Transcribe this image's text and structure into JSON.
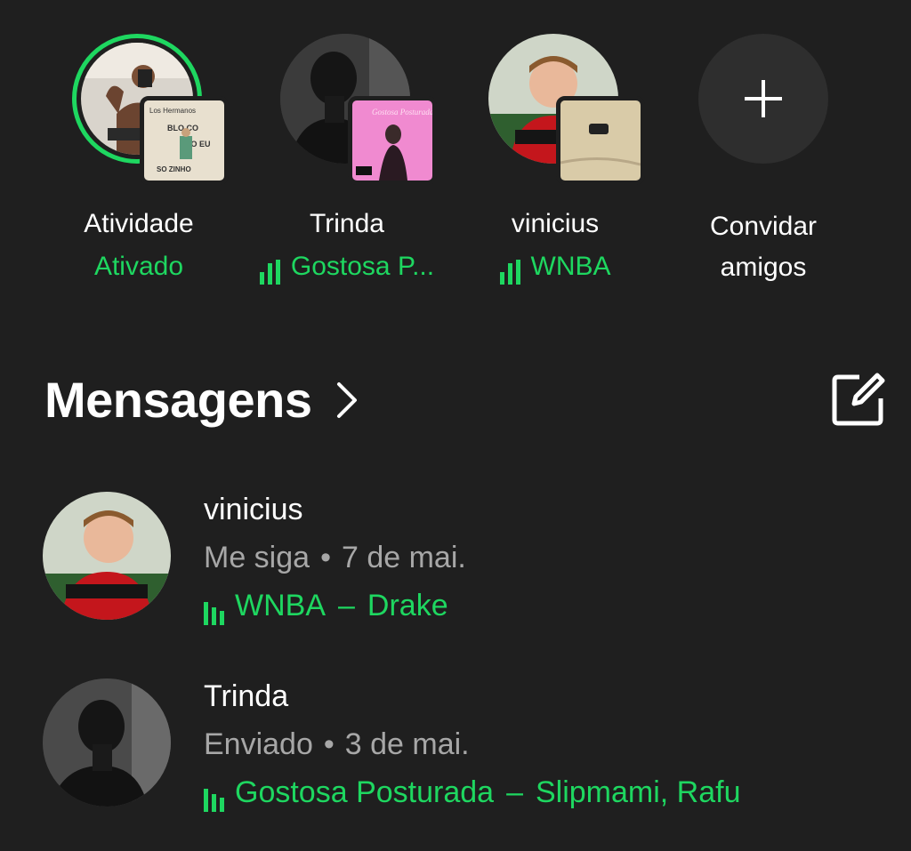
{
  "friends": [
    {
      "name": "Atividade",
      "status": "Ativado",
      "playing": false
    },
    {
      "name": "Trinda",
      "status": "Gostosa P...",
      "playing": true
    },
    {
      "name": "vinicius",
      "status": "WNBA",
      "playing": true
    }
  ],
  "invite": {
    "label": "Convidar amigos"
  },
  "cover_art": {
    "album1": {
      "line1": "Los Hermanos",
      "line2": "BLO CO",
      "line3": "DO EU",
      "line4": "SO ZINHO"
    },
    "album2": {
      "title": "Gostosa Posturada"
    }
  },
  "messages_section": {
    "title": "Mensagens"
  },
  "messages": [
    {
      "name": "vinicius",
      "status": "Me siga",
      "date": "7 de mai.",
      "track": "WNBA",
      "artist": "Drake"
    },
    {
      "name": "Trinda",
      "status": "Enviado",
      "date": "3 de mai.",
      "track": "Gostosa Posturada",
      "artist": "Slipmami, Rafu"
    }
  ],
  "colors": {
    "accent": "#1ed760",
    "background": "#1f1f1f",
    "muted": "#a7a7a7"
  }
}
